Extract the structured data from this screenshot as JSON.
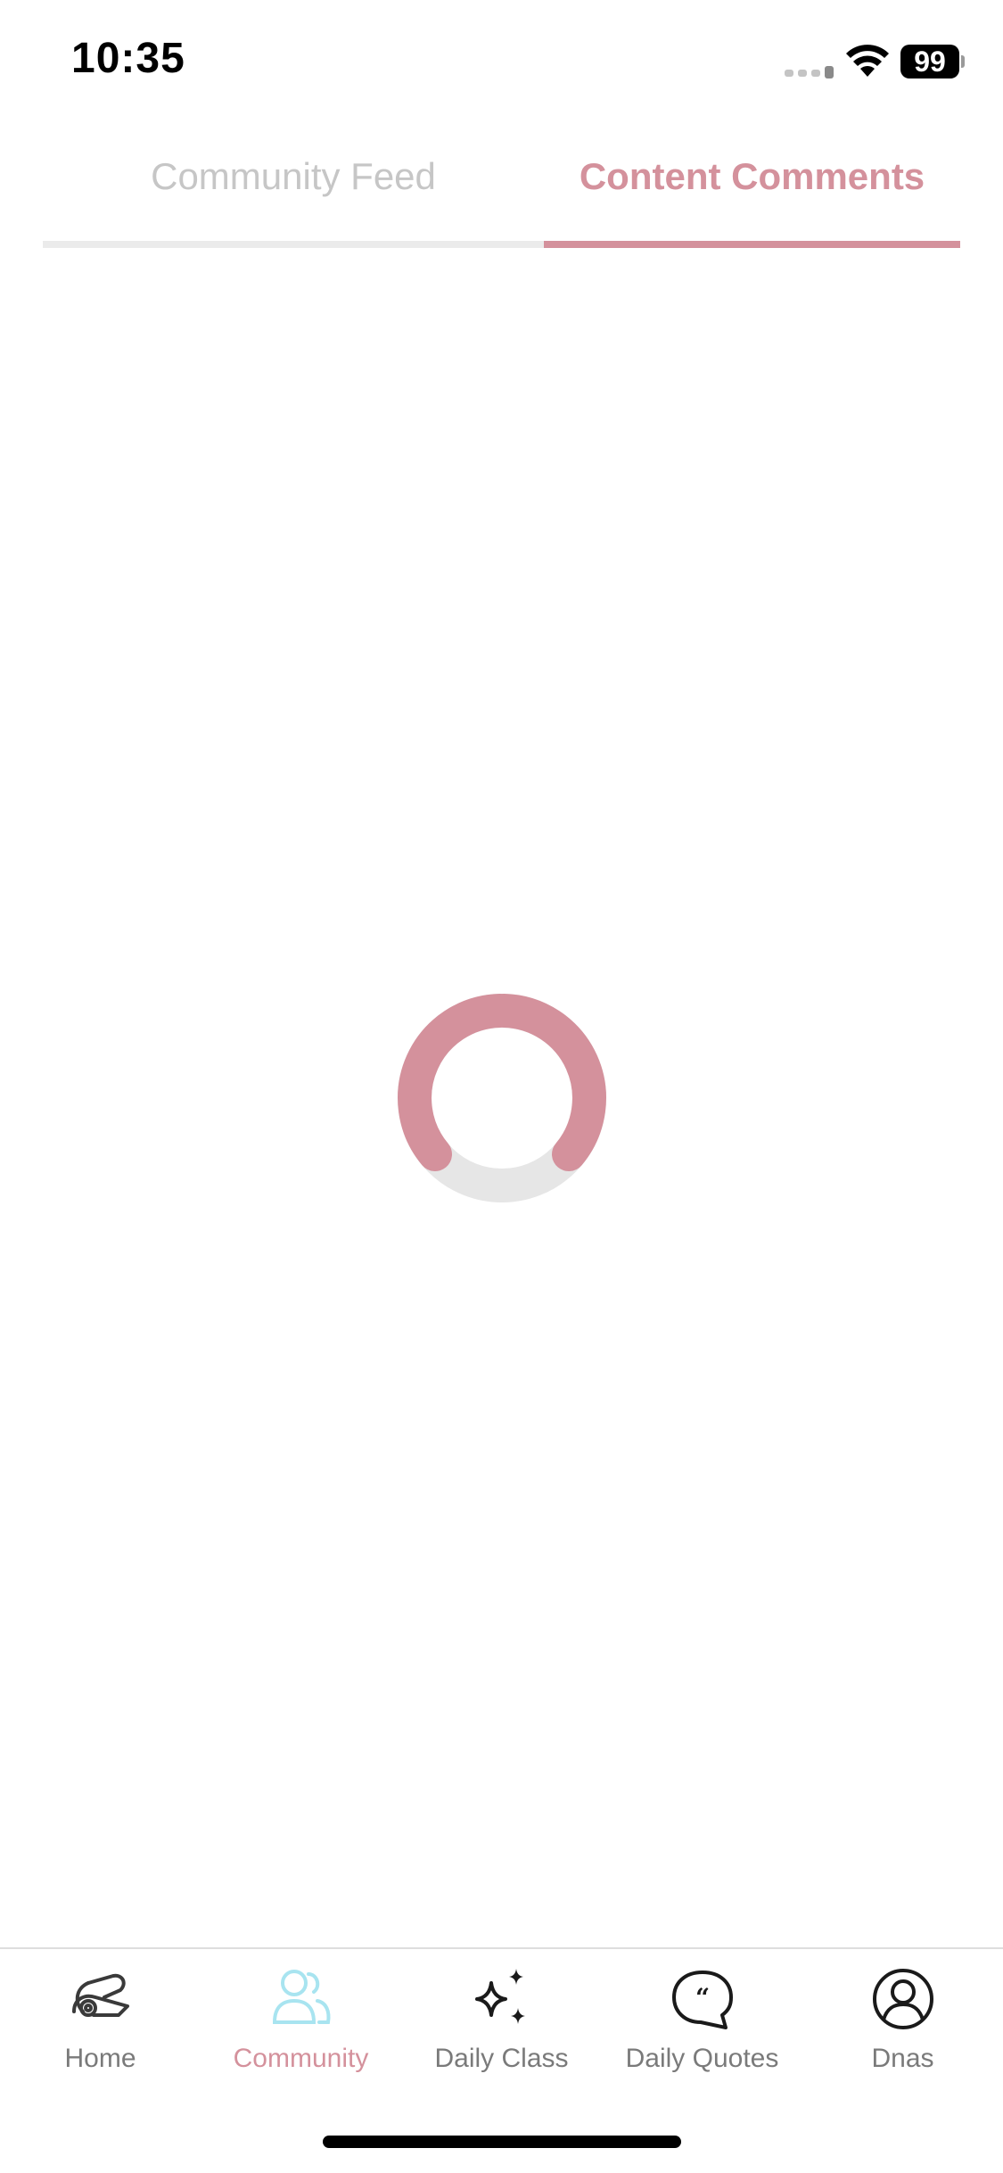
{
  "status_bar": {
    "time": "10:35",
    "battery": "99"
  },
  "tabs": [
    {
      "label": "Community Feed",
      "active": false
    },
    {
      "label": "Content Comments",
      "active": true
    }
  ],
  "colors": {
    "accent": "#d4919c",
    "active_nav_icon": "#a8e4f0",
    "inactive_tab": "#c6c6c6",
    "spinner_track": "#e6e6e6"
  },
  "loading": {
    "icon": "loading-spinner-icon"
  },
  "nav": {
    "items": [
      {
        "label": "Home",
        "icon": "yoga-mat-icon",
        "active": false
      },
      {
        "label": "Community",
        "icon": "people-icon",
        "active": true
      },
      {
        "label": "Daily Class",
        "icon": "sparkles-icon",
        "active": false
      },
      {
        "label": "Daily Quotes",
        "icon": "quote-bubble-icon",
        "active": false
      },
      {
        "label": "Dnas",
        "icon": "profile-icon",
        "active": false
      }
    ]
  }
}
